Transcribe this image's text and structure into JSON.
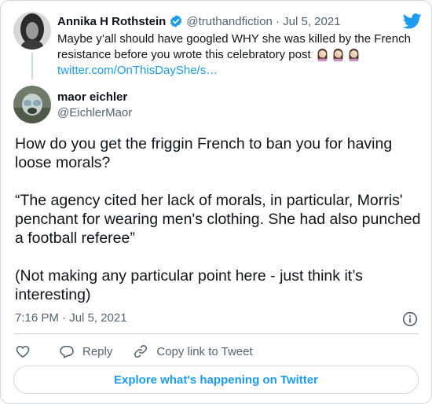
{
  "parent_tweet": {
    "author_name": "Annika H Rothstein",
    "handle": "@truthandfiction",
    "separator": " · ",
    "date": "Jul 5, 2021",
    "text": "Maybe y’all should have googled WHY she was killed by the French resistance before you wrote this celebratory post",
    "emoji_icon": "woman-facepalming-icon",
    "emoji_count": 3,
    "link": "twitter.com/OnThisDayShe/s…"
  },
  "tweet": {
    "author_name": "maor eichler",
    "handle": "@EichlerMaor",
    "paragraphs": [
      "How do you get the friggin French to ban you for having loose morals?",
      "“The agency cited her lack of morals, in particular, Morris' penchant for wearing men's clothing. She had also punched a football referee”",
      "(Not making any particular point here - just think it’s interesting)"
    ],
    "timestamp": "7:16 PM · Jul 5, 2021"
  },
  "actions": {
    "reply_label": "Reply",
    "copy_link_label": "Copy link to Tweet"
  },
  "footer": {
    "explore_label": "Explore what's happening on Twitter"
  },
  "colors": {
    "accent": "#1d9bf0",
    "text": "#0f1419",
    "secondary": "#536471",
    "border": "#cfd9de"
  }
}
